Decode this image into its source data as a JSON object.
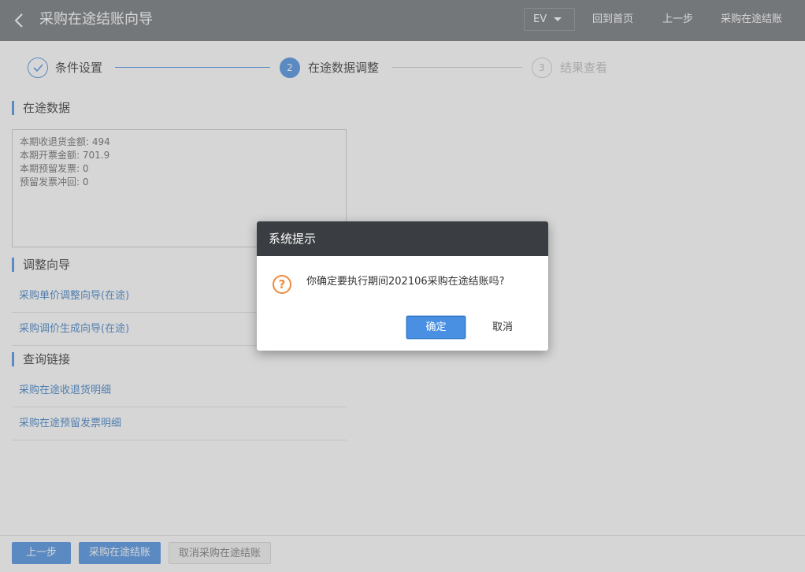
{
  "header": {
    "title": "采购在途结账向导",
    "ev_label": "EV",
    "links": [
      "回到首页",
      "上一步",
      "采购在途结账"
    ]
  },
  "steps": [
    {
      "label": "条件设置",
      "state": "done"
    },
    {
      "number": "2",
      "label": "在途数据调整",
      "state": "active"
    },
    {
      "number": "3",
      "label": "结果查看",
      "state": "pending"
    }
  ],
  "transit": {
    "title": "在途数据",
    "lines": [
      "本期收退货金额: 494",
      "本期开票金额: 701.9",
      "本期预留发票: 0",
      "预留发票冲回: 0"
    ]
  },
  "adjust": {
    "title": "调整向导",
    "links": [
      "采购单价调整向导(在途)",
      "采购调价生成向导(在途)"
    ]
  },
  "query": {
    "title": "查询链接",
    "links": [
      "采购在途收退货明细",
      "采购在途预留发票明细"
    ]
  },
  "footer": {
    "prev": "上一步",
    "close": "采购在途结账",
    "cancel_close": "取消采购在途结账"
  },
  "dialog": {
    "title": "系统提示",
    "icon": "?",
    "message": "你确定要执行期间202106采购在途结账吗?",
    "ok": "确定",
    "cancel": "取消"
  },
  "colors": {
    "header_bg": "#6f7378",
    "accent": "#4a90e2",
    "link": "#3c7fc7",
    "warning_icon": "#f08a3c",
    "dialog_head_bg": "#3a3d41"
  }
}
